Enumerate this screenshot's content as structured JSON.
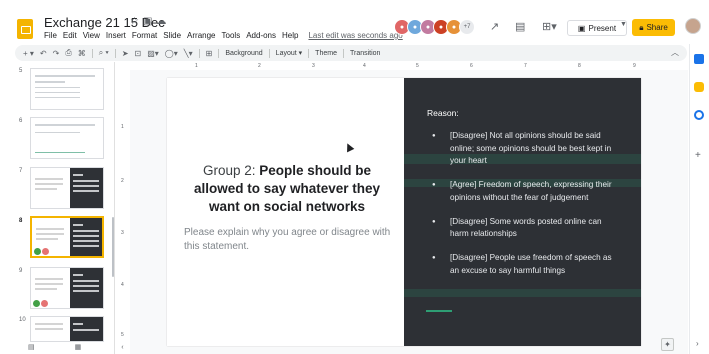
{
  "app": {
    "title": "Exchange 21 15 Dec",
    "last_edit": "Last edit was seconds ago"
  },
  "menu": [
    "File",
    "Edit",
    "View",
    "Insert",
    "Format",
    "Slide",
    "Arrange",
    "Tools",
    "Add-ons",
    "Help"
  ],
  "header": {
    "avatar_more": "+7",
    "present_label": "Present",
    "share_label": "Share"
  },
  "toolbar": {
    "background_label": "Background",
    "layout_label": "Layout",
    "theme_label": "Theme",
    "transition_label": "Transition"
  },
  "ruler": {
    "h_ticks": [
      "1",
      "2",
      "3",
      "4",
      "5",
      "6",
      "7",
      "8",
      "9"
    ],
    "v_ticks": [
      "1",
      "2",
      "3",
      "4",
      "5"
    ]
  },
  "filmstrip": {
    "slide_numbers": [
      "5",
      "6",
      "7",
      "8",
      "9",
      "10"
    ]
  },
  "slide": {
    "title_prefix": "Group 2: ",
    "title_bold": "People should be allowed to say whatever they want on social networks",
    "subtitle": "Please explain why you agree or disagree with this statement.",
    "reason_label": "Reason:",
    "bullets": [
      "[Disagree] Not all opinions should be said online; some opinions should be best kept in your heart",
      "[Agree] Freedom of speech, expressing their opinions without the fear of judgement",
      "[Disagree] Some words posted online can harm relationships",
      "[Disagree] People use freedom of speech as an excuse to say harmful things"
    ]
  },
  "colors": {
    "accent": "#fbbc04",
    "slide_dark": "#2d3035",
    "green_accent": "#2e9e74"
  }
}
